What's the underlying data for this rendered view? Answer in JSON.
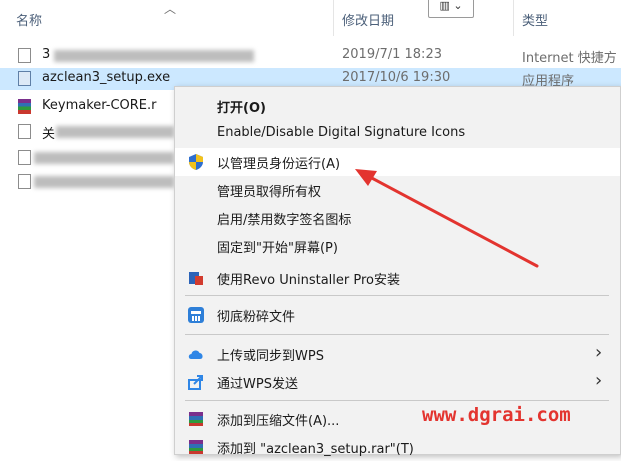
{
  "explorer": {
    "columns": {
      "name": "名称",
      "date": "修改日期",
      "type": "类型"
    },
    "files": [
      {
        "name": "3",
        "date": "2019/7/1 18:23",
        "type": "Internet 快捷方"
      },
      {
        "name": "azclean3_setup.exe",
        "date": "2017/10/6 19:30",
        "type": "应用程序"
      },
      {
        "name": "Keymaker-CORE.r",
        "date": "",
        "type": ""
      },
      {
        "name": "关",
        "date": "",
        "type": ""
      },
      {
        "name": "",
        "date": "",
        "type": ""
      },
      {
        "name": "",
        "date": "",
        "type": ""
      }
    ]
  },
  "context_menu": {
    "items": [
      {
        "label": "打开(O)"
      },
      {
        "label": "Enable/Disable Digital Signature Icons"
      },
      {
        "label": "以管理员身份运行(A)",
        "icon": "uac-shield-icon"
      },
      {
        "label": "管理员取得所有权"
      },
      {
        "label": "启用/禁用数字签名图标"
      },
      {
        "label": "固定到\"开始\"屏幕(P)"
      },
      {
        "label": "使用Revo Uninstaller Pro安装",
        "icon": "revo-uninstaller-icon"
      },
      {
        "label": "彻底粉碎文件",
        "icon": "shredder-icon"
      },
      {
        "label": "上传或同步到WPS",
        "icon": "wps-cloud-icon"
      },
      {
        "label": "通过WPS发送",
        "icon": "wps-send-icon"
      },
      {
        "label": "添加到压缩文件(A)...",
        "icon": "winrar-icon"
      },
      {
        "label": "添加到 \"azclean3_setup.rar\"(T)",
        "icon": "winrar-icon"
      }
    ]
  },
  "watermark": "www.dgrai.com",
  "colors": {
    "selection": "#cce8ff",
    "menu_bg": "#f2f2f2",
    "hover": "#ffffff",
    "arrow": "#e3342f",
    "header_text": "#4c607a"
  }
}
